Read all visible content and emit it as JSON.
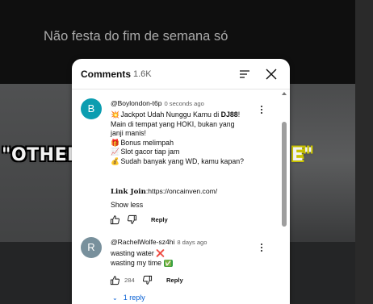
{
  "video": {
    "title": "Não festa do fim de semana só",
    "caption_left": "\"OTHERS",
    "caption_right": "E\""
  },
  "panel": {
    "title": "Comments",
    "count": "1.6K"
  },
  "comments": [
    {
      "avatar_letter": "B",
      "avatar_color": "#0b9db0",
      "author": "@Boylondon-t6p",
      "time": "0 seconds ago",
      "line1_emoji": "💥",
      "line1_text": " Jackpot Udah Nunggu Kamu di ",
      "line1_bold": "DJ88",
      "line1_end": "!",
      "line2": "Main di tempat yang HOKI, bukan yang",
      "line3": "janji manis!",
      "bullets": [
        {
          "emoji": "🎁",
          "text": " Bonus melimpah"
        },
        {
          "emoji": "📈",
          "text": " Slot gacor tiap jam"
        },
        {
          "emoji": "💰",
          "text": " Sudah banyak yang WD, kamu kapan?"
        }
      ],
      "link_label": "Link Join",
      "link_url": ":https://oncainven.com/",
      "show_less": "Show less",
      "reply_label": "Reply"
    },
    {
      "avatar_letter": "R",
      "avatar_color": "#78909c",
      "author": "@RachelWolfe-sz4hi",
      "time": "8 days ago",
      "line1": "wasting water ",
      "line1_emoji": "❌",
      "line2": "wasting my time ",
      "line2_emoji": "✅",
      "likes": "284",
      "reply_label": "Reply",
      "replies_toggle": "1 reply"
    }
  ]
}
